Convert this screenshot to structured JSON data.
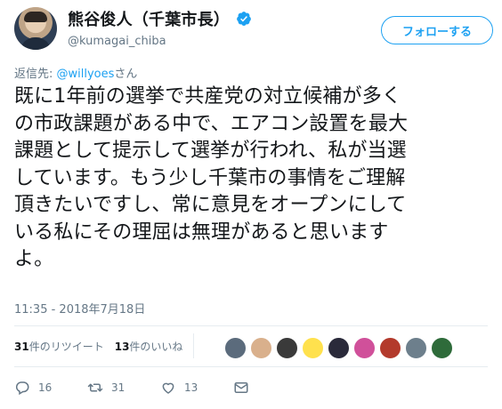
{
  "user": {
    "display_name": "熊谷俊人（千葉市長）",
    "handle": "@kumagai_chiba",
    "verified": true
  },
  "follow_button": {
    "label": "フォローする"
  },
  "reply": {
    "prefix": "返信先: ",
    "mention": "@willyoes",
    "suffix": "さん"
  },
  "tweet": {
    "lines": [
      "既に1年前の選挙で共産党の対立候補が多く",
      "の市政課題がある中で、エアコン設置を最大",
      "課題として提示して選挙が行われ、私が当選",
      "しています。もう少し千葉市の事情をご理解",
      "頂きたいですし、常に意見をオープンにして",
      "いる私にその理屈は無理があると思います",
      "よ。"
    ],
    "timestamp": "11:35 - 2018年7月18日"
  },
  "stats": {
    "retweets_count": "31",
    "retweets_label": "件のリツイート",
    "likes_count": "13",
    "likes_label": "件のいいね"
  },
  "likers": [
    {
      "color": "#5b6b7c"
    },
    {
      "color": "#d9b08c"
    },
    {
      "color": "#3a3a3a"
    },
    {
      "color": "#ffe14d"
    },
    {
      "color": "#2a2a3a"
    },
    {
      "color": "#d0509a"
    },
    {
      "color": "#b33a2c"
    },
    {
      "color": "#6d7f8c"
    },
    {
      "color": "#2e6b3a"
    }
  ],
  "actions": {
    "reply_count": "16",
    "retweet_count": "31",
    "like_count": "13"
  },
  "colors": {
    "accent": "#1da1f2",
    "muted": "#657786",
    "text": "#14171a",
    "divider": "#e6ecf0"
  }
}
